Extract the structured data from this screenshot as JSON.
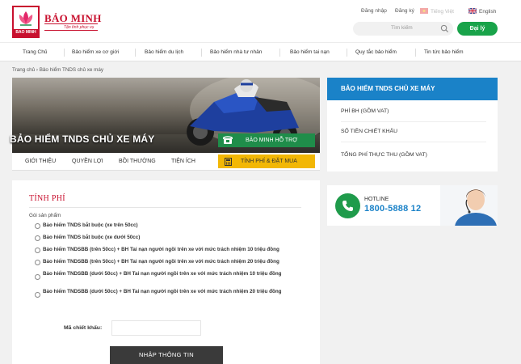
{
  "header": {
    "logo_text": "BẢO MINH",
    "logo_badge": "BAO MINH",
    "logo_tagline": "Tận tình phục vụ",
    "login": "Đăng nhập",
    "register": "Đăng ký",
    "lang_vi": "Tiếng Việt",
    "lang_en": "English",
    "search_placeholder": "Tìm kiếm",
    "agent_button": "Đại lý"
  },
  "nav": {
    "items": [
      {
        "label": "Trang Chủ"
      },
      {
        "label": "Bảo hiểm xe cơ giới"
      },
      {
        "label": "Bảo hiểm du lịch"
      },
      {
        "label": "Bảo hiểm nhà tư nhân"
      },
      {
        "label": "Bảo hiểm tai nạn"
      },
      {
        "label": "Quy tắc bảo hiểm"
      },
      {
        "label": "Tin tức bảo hiểm"
      }
    ]
  },
  "breadcrumb": {
    "home": "Trang chủ",
    "separator": "›",
    "current": "Bảo hiểm TNDS chủ xe máy"
  },
  "banner": {
    "title": "BẢO HIỂM TNDS CHỦ XE MÁY",
    "support_button": "BẢO MINH HỖ TRỢ"
  },
  "tabs": {
    "items": [
      {
        "label": "GIỚI THIỆU"
      },
      {
        "label": "QUYỀN LỢI"
      },
      {
        "label": "BỒI THƯỜNG"
      },
      {
        "label": "TIỆN ÍCH"
      }
    ],
    "calc_button": "TÍNH PHÍ & ĐẶT MUA"
  },
  "form": {
    "title": "TÍNH PHÍ",
    "group_label": "Gói sản phẩm",
    "options": [
      {
        "label": "Bảo hiểm TNDS bắt buộc (xe trên 50cc)"
      },
      {
        "label": "Bảo hiểm TNDS bắt buộc (xe dưới 50cc)"
      },
      {
        "label": "Bảo hiểm TNDSBB (trên 50cc) + BH Tai nạn người ngồi trên xe với mức trách nhiệm 10 triệu đồng"
      },
      {
        "label": "Bảo hiểm TNDSBB (trên 50cc) + BH Tai nạn người ngồi trên xe với mức trách nhiệm 20 triệu đồng"
      },
      {
        "label": "Bảo hiểm TNDSBB (dưới 50cc) + BH Tai nạn người ngồi trên xe với mức trách nhiệm 10 triệu đồng"
      },
      {
        "label": "Bảo hiểm TNDSBB (dưới 50cc) + BH Tai nạn người ngồi trên xe với mức trách nhiệm 20 triệu đồng"
      }
    ],
    "discount_label": "Mã chiết khấu:",
    "discount_value": "",
    "submit": "NHẬP THÔNG TIN"
  },
  "summary": {
    "title": "BẢO HIỂM TNDS CHỦ XE MÁY",
    "premium": "PHÍ BH (GỒM VAT)",
    "discount": "SỐ TIỀN CHIẾT KHẤU",
    "total": "TỔNG PHÍ THỰC THU (GỒM VAT)"
  },
  "hotline": {
    "label": "HOTLINE",
    "number": "1800-5888 12"
  },
  "colors": {
    "brand_red": "#c8102e",
    "accent_blue": "#1a82c8",
    "accent_green": "#1f8d4a",
    "accent_yellow": "#f2b705"
  }
}
